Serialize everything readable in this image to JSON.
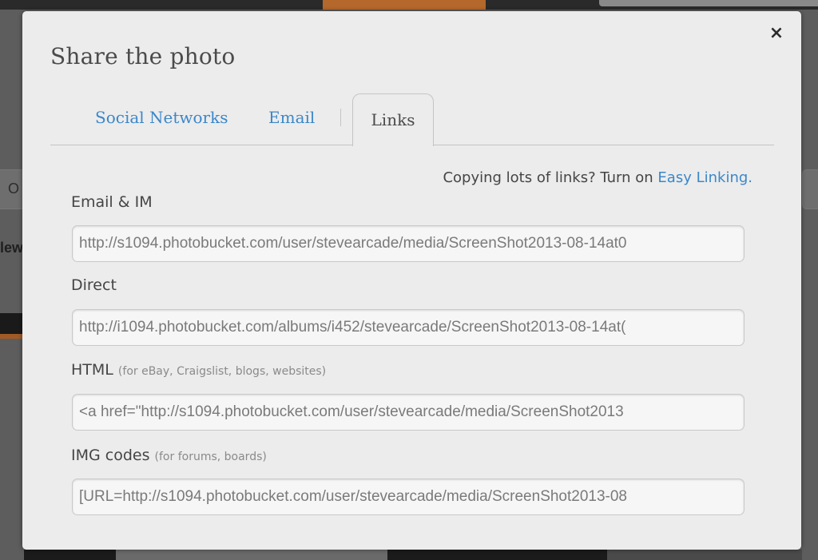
{
  "background": {
    "left_text_1": "O",
    "left_text_2": "lew"
  },
  "modal": {
    "title": "Share the photo",
    "close_icon": "×",
    "tabs": [
      {
        "label": "Social Networks",
        "active": false
      },
      {
        "label": "Email",
        "active": false
      },
      {
        "label": "Links",
        "active": true
      }
    ],
    "easy_linking": {
      "prefix": "Copying lots of links? Turn on ",
      "link": "Easy Linking."
    },
    "fields": [
      {
        "label": "Email & IM",
        "hint": "",
        "value": "http://s1094.photobucket.com/user/stevearcade/media/ScreenShot2013-08-14at0"
      },
      {
        "label": "Direct",
        "hint": "",
        "value": "http://i1094.photobucket.com/albums/i452/stevearcade/ScreenShot2013-08-14at("
      },
      {
        "label": "HTML",
        "hint": "(for eBay, Craigslist, blogs, websites)",
        "value": "<a href=\"http://s1094.photobucket.com/user/stevearcade/media/ScreenShot2013"
      },
      {
        "label": "IMG codes",
        "hint": "(for forums, boards)",
        "value": "[URL=http://s1094.photobucket.com/user/stevearcade/media/ScreenShot2013-08"
      }
    ]
  },
  "colors": {
    "link_blue": "#3b87c9",
    "modal_bg": "#ececec",
    "overlay": "#5f5f5f"
  }
}
